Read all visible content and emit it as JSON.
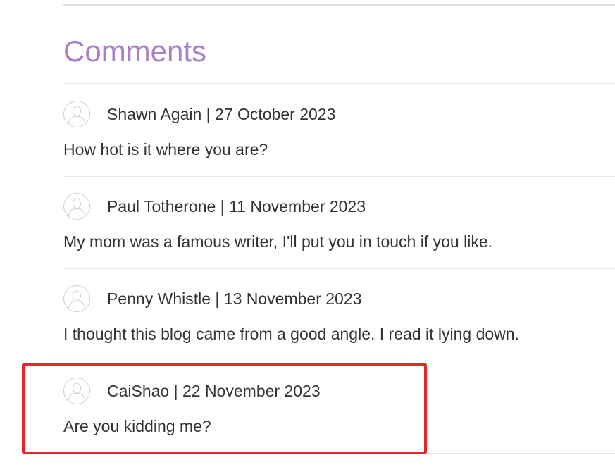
{
  "heading": "Comments",
  "comments": [
    {
      "author": "Shawn Again",
      "date": "27 October 2023",
      "text": "How hot is it where you are?"
    },
    {
      "author": "Paul Totherone",
      "date": "11 November 2023",
      "text": "My mom was a famous writer, I'll put you in touch if you like."
    },
    {
      "author": "Penny Whistle",
      "date": "13 November 2023",
      "text": "I thought this blog came from a good angle. I read it lying down."
    },
    {
      "author": "CaiShao",
      "date": "22 November 2023",
      "text": "Are you kidding me?"
    }
  ],
  "meta_separator": "|",
  "icons": {
    "avatar": "user-avatar-icon"
  },
  "colors": {
    "heading": "#a97fc6",
    "highlight_border": "#e8232a",
    "text": "#333333",
    "divider": "#e6e6e6"
  }
}
